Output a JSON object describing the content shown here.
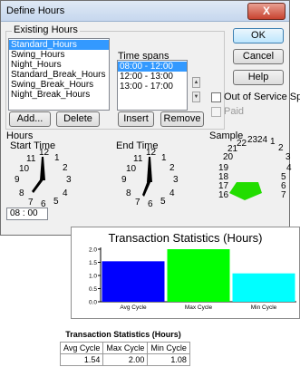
{
  "dialog": {
    "title": "Define Hours",
    "close_glyph": "X",
    "existing_hours_label": "Existing Hours",
    "hours_list": [
      {
        "label": "Standard_Hours",
        "selected": true
      },
      {
        "label": "Swing_Hours",
        "selected": false
      },
      {
        "label": "Night_Hours",
        "selected": false
      },
      {
        "label": "Standard_Break_Hours",
        "selected": false
      },
      {
        "label": "Swing_Break_Hours",
        "selected": false
      },
      {
        "label": "Night_Break_Hours",
        "selected": false
      }
    ],
    "time_spans_label": "Time spans",
    "time_spans": [
      {
        "label": "08:00 - 12:00",
        "selected": true
      },
      {
        "label": "12:00 - 13:00",
        "selected": false
      },
      {
        "label": "13:00 - 17:00",
        "selected": false
      }
    ],
    "buttons": {
      "ok": "OK",
      "cancel": "Cancel",
      "help": "Help",
      "add": "Add...",
      "delete": "Delete",
      "insert": "Insert",
      "remove": "Remove"
    },
    "out_of_service_label": "Out of Service Span",
    "paid_label": "Paid",
    "hours_group_label": "Hours",
    "start_time_label": "Start Time",
    "end_time_label": "End Time",
    "sample_label": "Sample",
    "start_time_value": "08 : 00",
    "start_clock_numbers": [
      "11",
      "12",
      "1",
      "10",
      "2",
      "9",
      "3",
      "8",
      "4",
      "7",
      "6",
      "5"
    ],
    "end_clock_numbers": [
      "11",
      "12",
      "1",
      "10",
      "2",
      "9",
      "3",
      "8",
      "4",
      "7",
      "6",
      "5"
    ],
    "sample_numbers": [
      "21",
      "22",
      "23",
      "24",
      "1",
      "2",
      "3",
      "20",
      "4",
      "19",
      "5",
      "18",
      "6",
      "17",
      "7",
      "16"
    ],
    "colors": {
      "sample_fill": "#22dd00",
      "selection": "#3399ff"
    }
  },
  "chart_data": {
    "type": "bar",
    "title": "Transaction Statistics (Hours)",
    "categories": [
      "Avg Cycle",
      "Max Cycle",
      "Min Cycle"
    ],
    "values": [
      1.54,
      2.0,
      1.08
    ],
    "colors": [
      "#0000ff",
      "#00ff00",
      "#00ffff"
    ],
    "ylim": [
      0,
      2.0
    ],
    "yticks": [
      "0.0",
      "0.5",
      "1.0",
      "1.5",
      "2.0"
    ],
    "grid": false
  },
  "table": {
    "title": "Transaction Statistics (Hours)",
    "headers": [
      "Avg Cycle",
      "Max Cycle",
      "Min Cycle"
    ],
    "row": [
      "1.54",
      "2.00",
      "1.08"
    ]
  }
}
